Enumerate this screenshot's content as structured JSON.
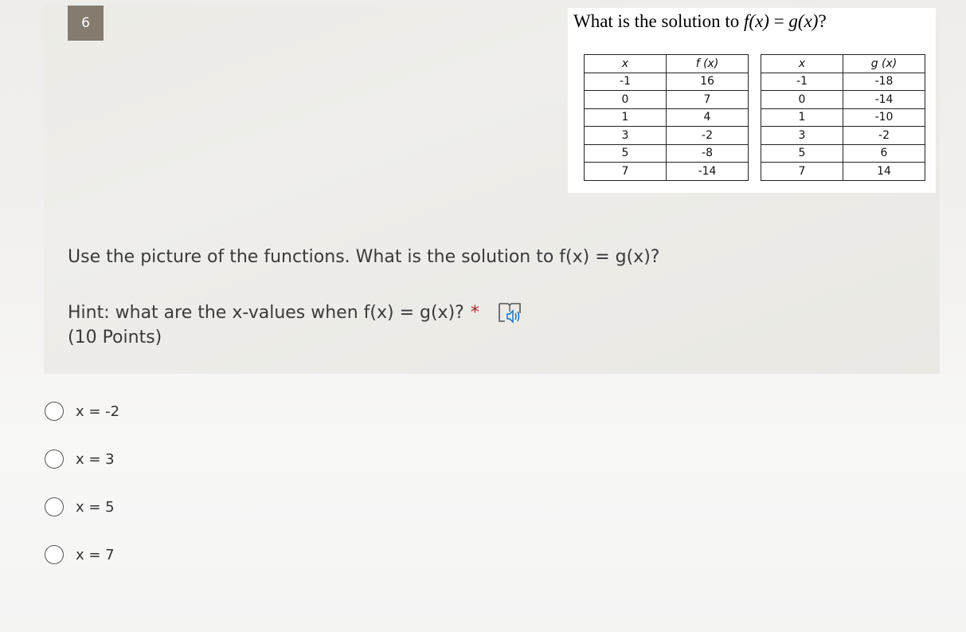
{
  "question": {
    "number": "6",
    "image": {
      "title_prefix": "What is the solution to ",
      "title_f": "f(x)",
      "title_eq": " = ",
      "title_g": "g(x)",
      "title_suffix": "?",
      "table_f": {
        "headers": [
          "x",
          "f (x)"
        ],
        "rows": [
          [
            "-1",
            "16"
          ],
          [
            "0",
            "7"
          ],
          [
            "1",
            "4"
          ],
          [
            "3",
            "-2"
          ],
          [
            "5",
            "-8"
          ],
          [
            "7",
            "-14"
          ]
        ]
      },
      "table_g": {
        "headers": [
          "x",
          "g (x)"
        ],
        "rows": [
          [
            "-1",
            "-18"
          ],
          [
            "0",
            "-14"
          ],
          [
            "1",
            "-10"
          ],
          [
            "3",
            "-2"
          ],
          [
            "5",
            "6"
          ],
          [
            "7",
            "14"
          ]
        ]
      }
    },
    "prompt": "Use the picture of the functions. What is the solution to f(x) = g(x)?",
    "hint": "Hint: what are the x-values when f(x) = g(x)?",
    "required_marker": "*",
    "points": "(10 Points)",
    "immersive_reader_icon": "immersive-reader-icon"
  },
  "choices": [
    {
      "label": "x = -2"
    },
    {
      "label": "x = 3"
    },
    {
      "label": "x = 5"
    },
    {
      "label": "x = 7"
    }
  ],
  "colors": {
    "number_badge": "#837c6f",
    "required": "#a4262c",
    "reader_accent": "#0f6cbd"
  }
}
